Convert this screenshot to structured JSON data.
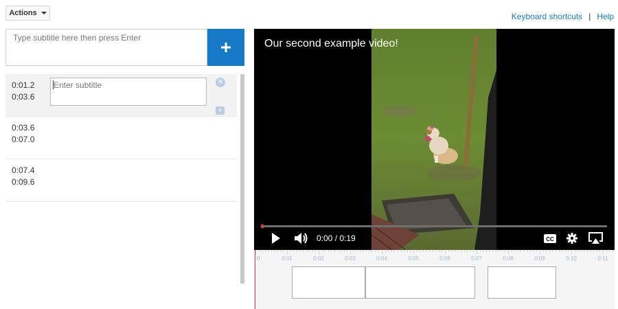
{
  "toolbar": {
    "actions_label": "Actions"
  },
  "links": {
    "shortcuts": "Keyboard shortcuts",
    "separator": "|",
    "help": "Help"
  },
  "new_subtitle": {
    "placeholder": "Type subtitle here then press Enter",
    "add_icon": "plus-icon"
  },
  "subtitles": [
    {
      "start": "0:01.2",
      "end": "0:03.6",
      "text_placeholder": "Enter subtitle"
    },
    {
      "start": "0:03.6",
      "end": "0:07.0"
    },
    {
      "start": "0:07.4",
      "end": "0:09.6"
    }
  ],
  "video": {
    "overlay_title": "Our second example video!",
    "time": "0:00 / 0:19",
    "progress": 0.0
  },
  "timeline": {
    "ticks": [
      "0",
      "0:01",
      "0:02",
      "0:03",
      "0:04",
      "0:05",
      "0:06",
      "0:07",
      "0:08",
      "0:09",
      "0:10",
      "0:11"
    ]
  },
  "colors": {
    "accent": "#167ac6",
    "playhead": "#e53935"
  }
}
